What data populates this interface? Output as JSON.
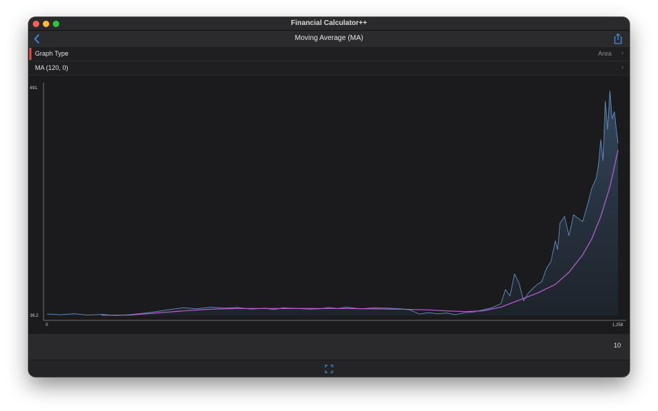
{
  "window": {
    "title": "Financial Calculator++"
  },
  "navbar": {
    "title": "Moving Average (MA)",
    "back_icon": "chevron-left-icon",
    "share_icon": "share-icon"
  },
  "settings": {
    "graph_type": {
      "label": "Graph Type",
      "value": "Area"
    },
    "ma_params": {
      "label": "MA (120, 0)",
      "value": ""
    }
  },
  "chart_data": {
    "type": "area",
    "title": "",
    "xlabel": "",
    "ylabel": "",
    "x_range": [
      0,
      1258
    ],
    "y_range": [
      36.2,
      691
    ],
    "x_tick_labels": [
      "0",
      "1,258"
    ],
    "y_tick_labels": [
      "36.2",
      "691."
    ],
    "series": [
      {
        "kind": "area-line",
        "color": "#5f8fc0",
        "points": [
          [
            0,
            40
          ],
          [
            30,
            38
          ],
          [
            60,
            41
          ],
          [
            90,
            37
          ],
          [
            120,
            39
          ],
          [
            150,
            36
          ],
          [
            180,
            38
          ],
          [
            210,
            42
          ],
          [
            240,
            47
          ],
          [
            270,
            53
          ],
          [
            300,
            58
          ],
          [
            330,
            55
          ],
          [
            360,
            60
          ],
          [
            390,
            57
          ],
          [
            420,
            59
          ],
          [
            450,
            54
          ],
          [
            480,
            57
          ],
          [
            500,
            53
          ],
          [
            520,
            58
          ],
          [
            550,
            56
          ],
          [
            580,
            54
          ],
          [
            600,
            55
          ],
          [
            620,
            59
          ],
          [
            640,
            56
          ],
          [
            660,
            60
          ],
          [
            690,
            55
          ],
          [
            720,
            58
          ],
          [
            750,
            57
          ],
          [
            780,
            55
          ],
          [
            800,
            52
          ],
          [
            820,
            40
          ],
          [
            840,
            44
          ],
          [
            860,
            41
          ],
          [
            880,
            43
          ],
          [
            900,
            38
          ],
          [
            920,
            44
          ],
          [
            940,
            46
          ],
          [
            960,
            52
          ],
          [
            980,
            58
          ],
          [
            1000,
            70
          ],
          [
            1010,
            110
          ],
          [
            1020,
            92
          ],
          [
            1030,
            155
          ],
          [
            1040,
            128
          ],
          [
            1050,
            78
          ],
          [
            1060,
            100
          ],
          [
            1070,
            113
          ],
          [
            1080,
            125
          ],
          [
            1090,
            133
          ],
          [
            1100,
            170
          ],
          [
            1110,
            190
          ],
          [
            1120,
            250
          ],
          [
            1125,
            225
          ],
          [
            1130,
            300
          ],
          [
            1140,
            320
          ],
          [
            1150,
            265
          ],
          [
            1160,
            325
          ],
          [
            1170,
            315
          ],
          [
            1180,
            305
          ],
          [
            1190,
            350
          ],
          [
            1200,
            400
          ],
          [
            1210,
            430
          ],
          [
            1215,
            470
          ],
          [
            1220,
            540
          ],
          [
            1225,
            480
          ],
          [
            1230,
            650
          ],
          [
            1235,
            570
          ],
          [
            1240,
            680
          ],
          [
            1245,
            600
          ],
          [
            1250,
            620
          ],
          [
            1255,
            560
          ],
          [
            1258,
            530
          ]
        ]
      },
      {
        "kind": "line",
        "color": "#c05bd6",
        "points": [
          [
            120,
            37
          ],
          [
            180,
            37
          ],
          [
            240,
            43
          ],
          [
            300,
            49
          ],
          [
            360,
            54
          ],
          [
            420,
            56
          ],
          [
            480,
            56
          ],
          [
            540,
            56
          ],
          [
            600,
            56
          ],
          [
            660,
            56
          ],
          [
            720,
            55
          ],
          [
            780,
            54
          ],
          [
            840,
            52
          ],
          [
            880,
            49
          ],
          [
            920,
            47
          ],
          [
            960,
            49
          ],
          [
            1000,
            60
          ],
          [
            1040,
            80
          ],
          [
            1080,
            100
          ],
          [
            1120,
            125
          ],
          [
            1150,
            160
          ],
          [
            1180,
            210
          ],
          [
            1200,
            255
          ],
          [
            1220,
            320
          ],
          [
            1240,
            405
          ],
          [
            1258,
            510
          ]
        ]
      }
    ]
  },
  "bottom": {
    "value": "10"
  },
  "footer": {
    "expand_icon": "expand-icon"
  }
}
